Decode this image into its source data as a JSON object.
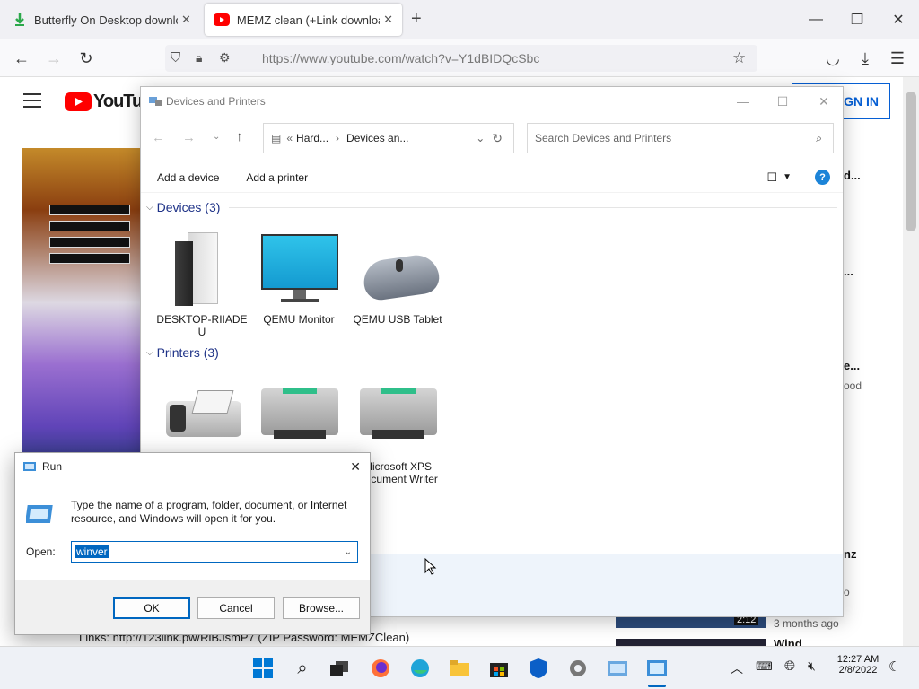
{
  "browser": {
    "tabs": [
      {
        "title": "Butterfly On Desktop download",
        "active": false
      },
      {
        "title": "MEMZ clean (+Link download)",
        "active": true
      }
    ],
    "new_tab": "+",
    "url": "https://www.youtube.com/watch?v=Y1dBIDQcSbc"
  },
  "youtube": {
    "logo": "YouTube",
    "sign_in": "SIGN IN",
    "sidebar_titles": [
      "d...",
      "...",
      "e...",
      "nz"
    ],
    "sidebar_meta": [
      "ood",
      "o",
      "3 months ago"
    ],
    "duration": "2:12",
    "sidebar_bottom": "Wind",
    "description_link": "Links: http://123link.pw/RiBJsmP7 (ZIP Password: MEMZClean)"
  },
  "devices_window": {
    "title": "Devices and Printers",
    "breadcrumb": [
      "Hard...",
      "Devices an..."
    ],
    "search_placeholder": "Search Devices and Printers",
    "commands": [
      "Add a device",
      "Add a printer"
    ],
    "devices_group": "Devices (3)",
    "printers_group": "Printers (3)",
    "devices": [
      "DESKTOP-RIIADE U",
      "QEMU Monitor",
      "QEMU USB Tablet"
    ],
    "printers": [
      "",
      "",
      "Microsoft XPS Document Writer"
    ]
  },
  "run_dialog": {
    "title": "Run",
    "description": "Type the name of a program, folder, document, or Internet resource, and Windows will open it for you.",
    "open_label": "Open:",
    "value": "winver",
    "ok": "OK",
    "cancel": "Cancel",
    "browse": "Browse..."
  },
  "taskbar": {
    "time": "12:27 AM",
    "date": "2/8/2022"
  },
  "colors": {
    "accent": "#0067c0",
    "youtube_red": "#ff0000",
    "group_header": "#1e3287"
  }
}
